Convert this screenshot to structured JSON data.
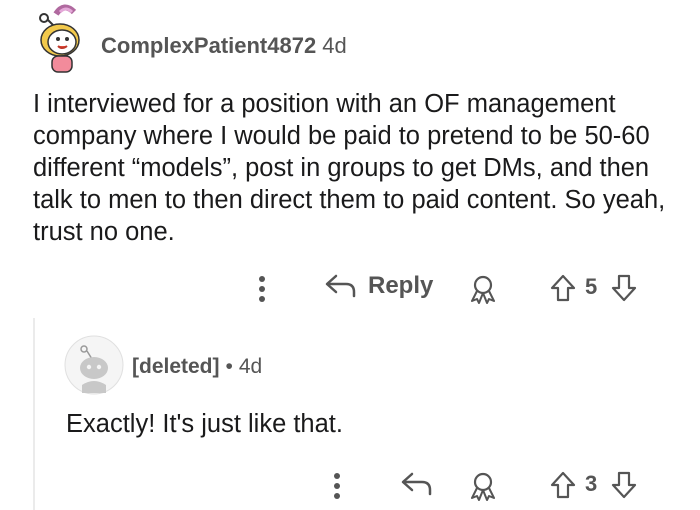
{
  "comment": {
    "username": "ComplexPatient4872",
    "age": "4d",
    "body": "I interviewed for a position with an OF management company where I would be paid to pretend to be 50-60 different “models”, post in groups to get DMs, and then talk to men to then direct them to paid content. So yeah, trust no one.",
    "actions": {
      "reply_label": "Reply",
      "vote_count": "5"
    }
  },
  "reply": {
    "username": "[deleted]",
    "separator": "•",
    "age": "4d",
    "body": "Exactly! It's just like that.",
    "actions": {
      "vote_count": "3"
    }
  },
  "colors": {
    "text": "#1a1a1b",
    "meta": "#555555",
    "thread_line": "#ebebeb"
  }
}
